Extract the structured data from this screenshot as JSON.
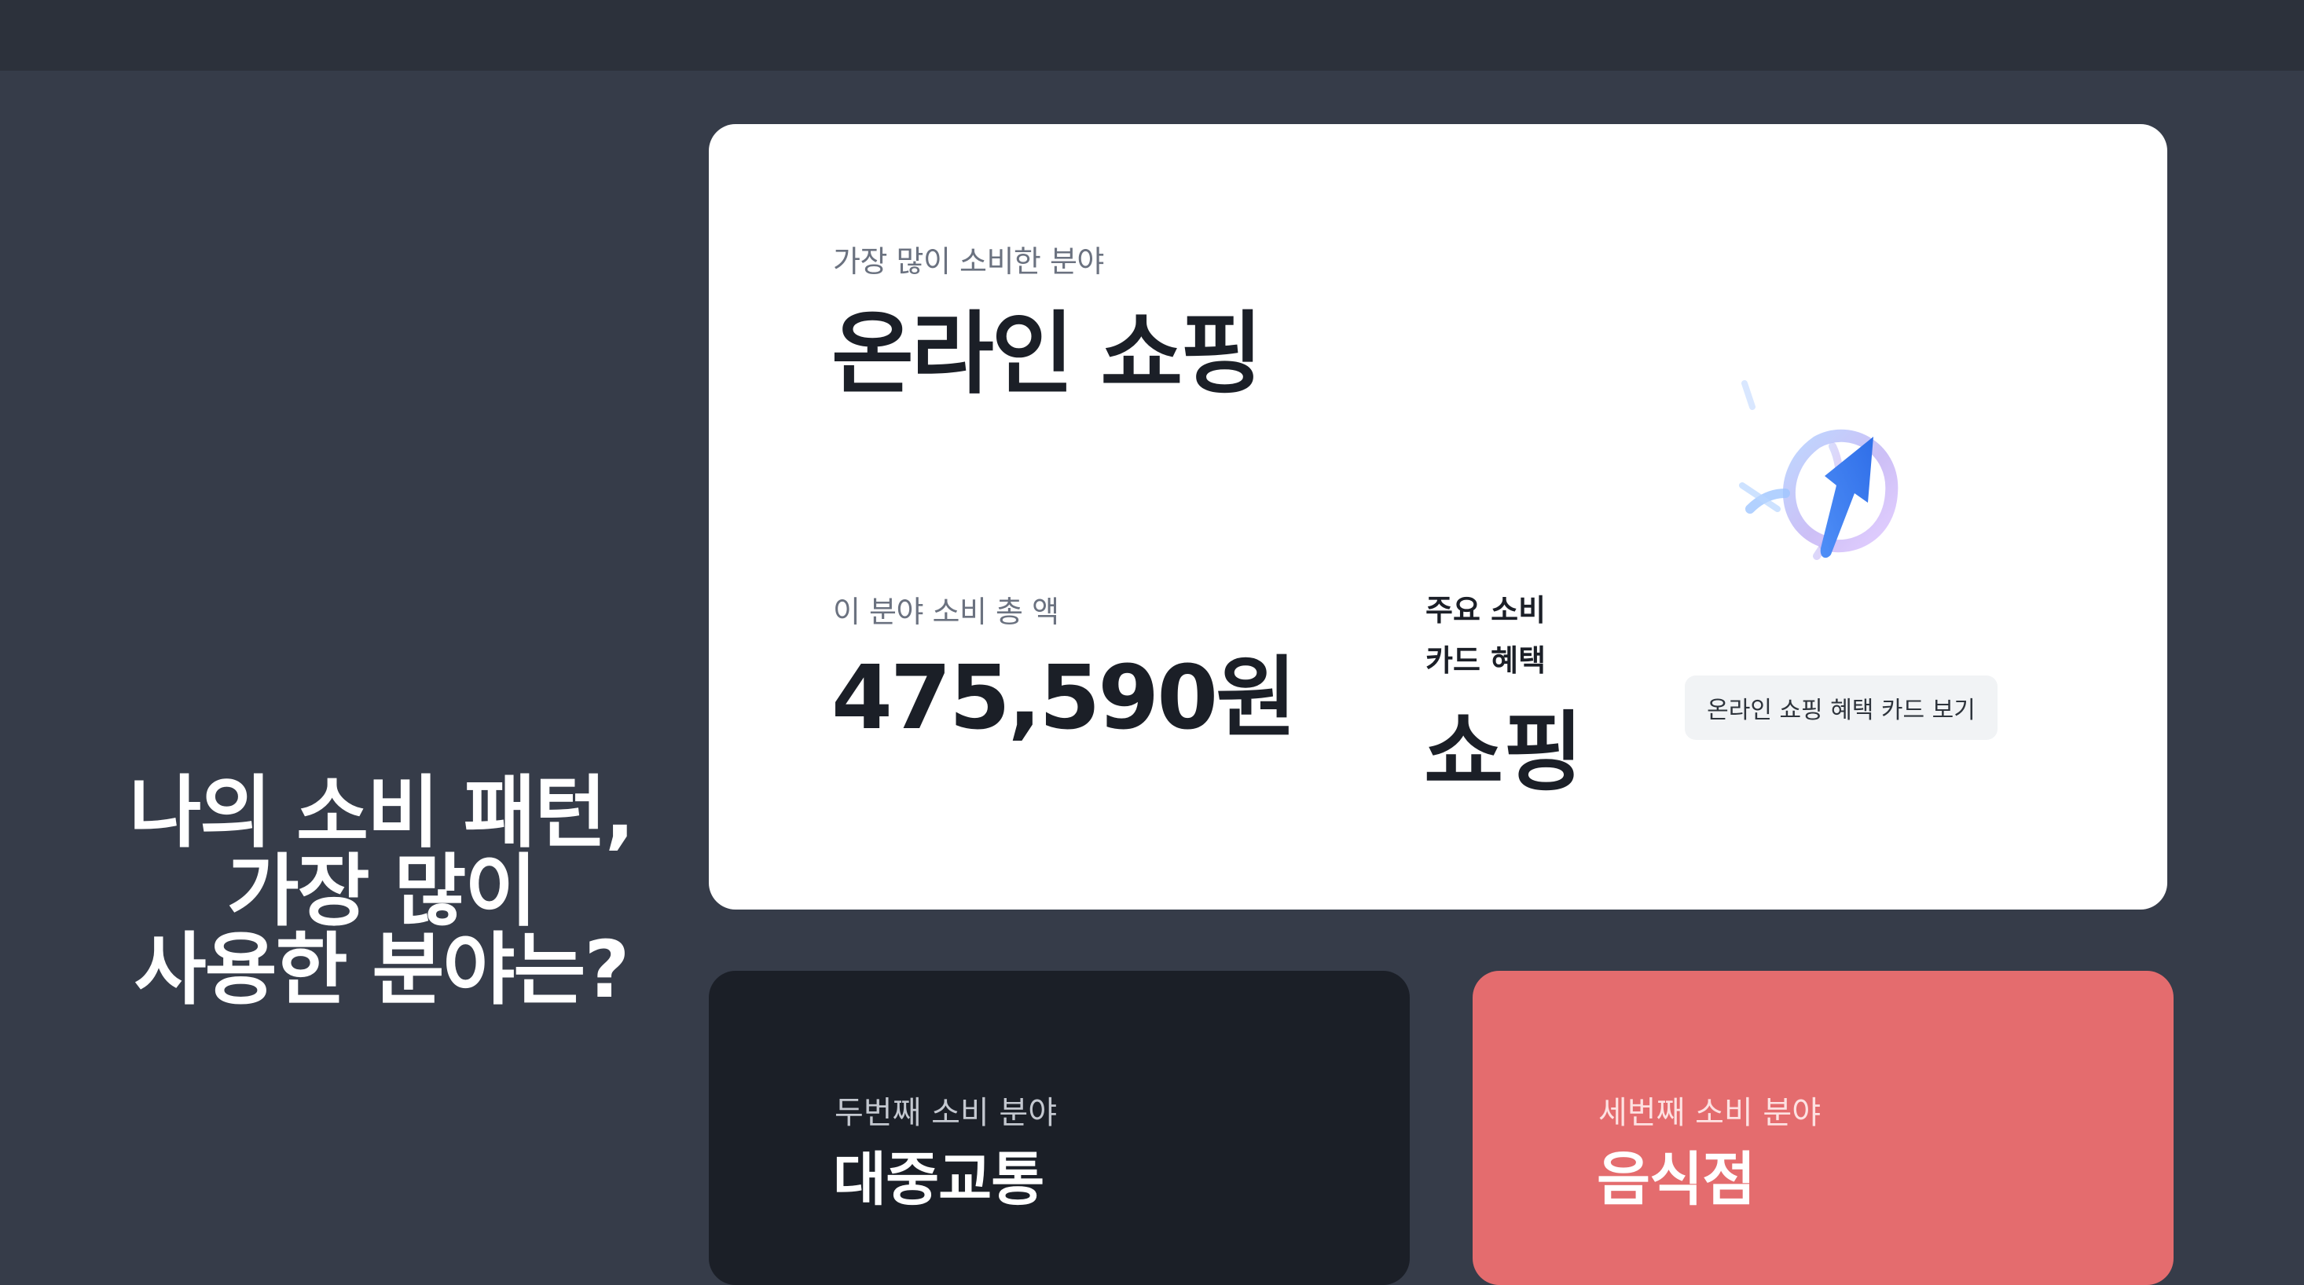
{
  "nav": {
    "items": [
      "",
      "",
      ""
    ]
  },
  "headline": {
    "lines": [
      "나의 소비 패턴,",
      "가장 많이",
      "사용한 분야는?"
    ]
  },
  "top_category": {
    "label": "가장 많이 소비한 분야",
    "value": "온라인 쇼핑",
    "total_label": "이 분야 소비 총 액",
    "total_value": "475,590원",
    "benefit_label_line1": "주요 소비",
    "benefit_label_line2": "카드 혜택",
    "benefit_value": "쇼핑",
    "button_label": "온라인 쇼핑 혜택 카드 보기",
    "graphic_icon": "trending-arrow-icon"
  },
  "second_category": {
    "label": "두번째 소비 분야",
    "value": "대중교통"
  },
  "third_category": {
    "label": "세번째 소비 분야",
    "value": "음식점"
  },
  "colors": {
    "background": "#363c49",
    "topbar": "#2c313b",
    "card_main": "#ffffff",
    "card_dark": "#1b1f27",
    "card_red": "#e46c6e",
    "accent_blue": "#3b7bf0"
  }
}
